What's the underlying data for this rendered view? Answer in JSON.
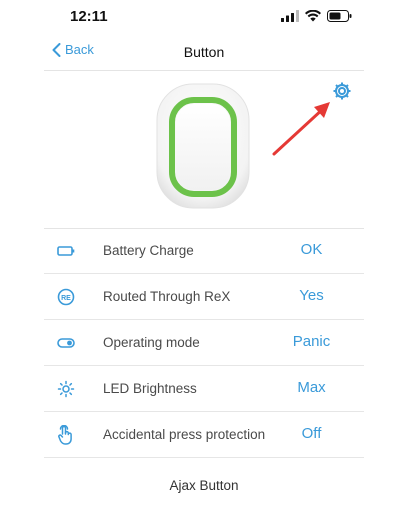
{
  "status_bar": {
    "time": "12:11",
    "icons": [
      "signal-icon",
      "wifi-icon",
      "battery-icon"
    ]
  },
  "nav": {
    "back_label": "Back",
    "title": "Button"
  },
  "device": {
    "image": "ajax-button-device",
    "accent_color": "#6cc24a"
  },
  "settings": {
    "icon": "gear-icon"
  },
  "rows": [
    {
      "icon": "battery-icon",
      "label": "Battery Charge",
      "value": "OK"
    },
    {
      "icon": "rex-icon",
      "label": "Routed Through ReX",
      "value": "Yes"
    },
    {
      "icon": "toggle-icon",
      "label": "Operating mode",
      "value": "Panic"
    },
    {
      "icon": "brightness-icon",
      "label": "LED Brightness",
      "value": "Max"
    },
    {
      "icon": "hand-press-icon",
      "label": "Accidental press protection",
      "value": "Off"
    }
  ],
  "footer": {
    "device_name": "Ajax Button"
  },
  "colors": {
    "accent": "#3a9ad9",
    "annotation_arrow": "#e53935"
  }
}
